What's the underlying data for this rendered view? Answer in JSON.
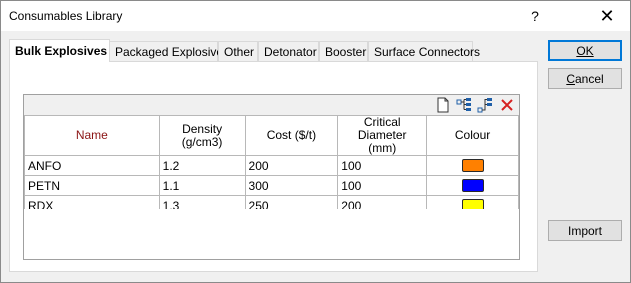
{
  "window": {
    "title": "Consumables Library",
    "help_label": "?",
    "close_label": "✕"
  },
  "tabs": [
    {
      "label": "Bulk Explosives",
      "active": true
    },
    {
      "label": "Packaged Explosives",
      "active": false
    },
    {
      "label": "Other",
      "active": false
    },
    {
      "label": "Detonator",
      "active": false
    },
    {
      "label": "Booster",
      "active": false
    },
    {
      "label": "Surface Connectors",
      "active": false
    }
  ],
  "toolbar": {
    "icons": [
      "new-document-icon",
      "insert-row-icon",
      "append-row-icon",
      "delete-icon"
    ],
    "delete_color": "#d62020"
  },
  "table": {
    "columns": [
      "Name",
      "Density (g/cm3)",
      "Cost ($/t)",
      "Critical Diameter\n(mm)",
      "Colour"
    ],
    "rows": [
      {
        "name": "ANFO",
        "density": "1.2",
        "cost": "200",
        "critical_diameter": "100",
        "colour": "#ff8000"
      },
      {
        "name": "PETN",
        "density": "1.1",
        "cost": "300",
        "critical_diameter": "100",
        "colour": "#0000ff"
      },
      {
        "name": "RDX",
        "density": "1.3",
        "cost": "250",
        "critical_diameter": "200",
        "colour": "#ffff00"
      }
    ]
  },
  "buttons": {
    "ok_label": "OK",
    "cancel_label": "Cancel",
    "import_label": "Import"
  }
}
